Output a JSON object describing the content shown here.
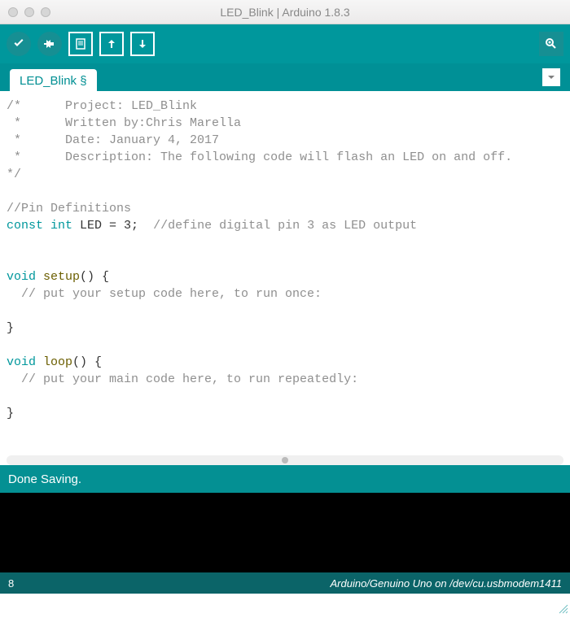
{
  "window": {
    "title": "LED_Blink | Arduino 1.8.3"
  },
  "tabs": {
    "active": "LED_Blink §"
  },
  "code": {
    "l1a": "/*",
    "l1b": "      Project: LED_Blink",
    "l2a": " *",
    "l2b": "      Written by:Chris Marella",
    "l3a": " *",
    "l3b": "      Date: January 4, 2017",
    "l4a": " *",
    "l4b": "      Description: The following code will flash an LED on and off.",
    "l5": "*/",
    "blank": "",
    "l6": "//Pin Definitions",
    "l7_const": "const",
    "l7_int": " int",
    "l7_rest": " LED = 3;  ",
    "l7_cmt": "//define digital pin 3 as LED output",
    "l8_void": "void",
    "l8_fn": " setup",
    "l8_rest": "() {",
    "l9": "  // put your setup code here, to run once:",
    "l10": "}",
    "l11_void": "void",
    "l11_fn": " loop",
    "l11_rest": "() {",
    "l12": "  // put your main code here, to run repeatedly:",
    "l13": "}"
  },
  "status": {
    "message": "Done Saving."
  },
  "footer": {
    "line": "8",
    "board": "Arduino/Genuino Uno on /dev/cu.usbmodem1411"
  }
}
